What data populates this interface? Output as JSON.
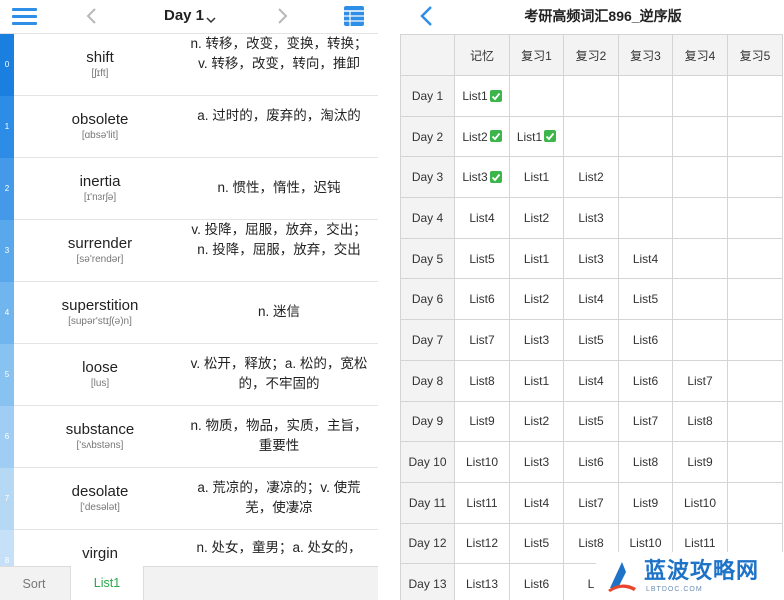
{
  "left_panel": {
    "header": {
      "title": "Day 1"
    },
    "rail_numbers": [
      "0",
      "1",
      "2",
      "3",
      "4",
      "5",
      "6",
      "7",
      "8"
    ],
    "words": [
      {
        "word": "shift",
        "phonetic": "[ʃɪft]",
        "definition": "n. 转移，改变，变换，转换；v. 转移，改变，转向，推卸"
      },
      {
        "word": "obsolete",
        "phonetic": "[ɑbsə'lit]",
        "definition": "a. 过时的，废弃的，淘汰的"
      },
      {
        "word": "inertia",
        "phonetic": "[ɪ'nɜrʃə]",
        "definition": "n. 惯性，惰性，迟钝"
      },
      {
        "word": "surrender",
        "phonetic": "[sə'rendər]",
        "definition": "v. 投降，屈服，放弃，交出；n. 投降，屈服，放弃，交出"
      },
      {
        "word": "superstition",
        "phonetic": "[supər'stɪʃ(ə)n]",
        "definition": "n. 迷信"
      },
      {
        "word": "loose",
        "phonetic": "[lus]",
        "definition": "v. 松开，释放；a. 松的，宽松的，不牢固的"
      },
      {
        "word": "substance",
        "phonetic": "['sʌbstəns]",
        "definition": "n. 物质，物品，实质，主旨，重要性"
      },
      {
        "word": "desolate",
        "phonetic": "['desələt]",
        "definition": "a. 荒凉的，凄凉的；v. 使荒芜，使凄凉"
      },
      {
        "word": "virgin",
        "phonetic": "",
        "definition": "n. 处女，童男；a. 处女的，"
      }
    ],
    "tabs": {
      "sort": "Sort",
      "list1": "List1"
    }
  },
  "right_panel": {
    "title": "考研高频词汇896_逆序版",
    "columns": [
      "",
      "记忆",
      "复习1",
      "复习2",
      "复习3",
      "复习4",
      "复习5"
    ],
    "rows": [
      {
        "day": "Day 1",
        "cells": [
          "List1",
          "",
          "",
          "",
          "",
          ""
        ],
        "checks": [
          true,
          false,
          false,
          false,
          false,
          false
        ]
      },
      {
        "day": "Day 2",
        "cells": [
          "List2",
          "List1",
          "",
          "",
          "",
          ""
        ],
        "checks": [
          true,
          true,
          false,
          false,
          false,
          false
        ]
      },
      {
        "day": "Day 3",
        "cells": [
          "List3",
          "List1",
          "List2",
          "",
          "",
          ""
        ],
        "checks": [
          true,
          false,
          false,
          false,
          false,
          false
        ]
      },
      {
        "day": "Day 4",
        "cells": [
          "List4",
          "List2",
          "List3",
          "",
          "",
          ""
        ],
        "checks": [
          false,
          false,
          false,
          false,
          false,
          false
        ]
      },
      {
        "day": "Day 5",
        "cells": [
          "List5",
          "List1",
          "List3",
          "List4",
          "",
          ""
        ],
        "checks": [
          false,
          false,
          false,
          false,
          false,
          false
        ]
      },
      {
        "day": "Day 6",
        "cells": [
          "List6",
          "List2",
          "List4",
          "List5",
          "",
          ""
        ],
        "checks": [
          false,
          false,
          false,
          false,
          false,
          false
        ]
      },
      {
        "day": "Day 7",
        "cells": [
          "List7",
          "List3",
          "List5",
          "List6",
          "",
          ""
        ],
        "checks": [
          false,
          false,
          false,
          false,
          false,
          false
        ]
      },
      {
        "day": "Day 8",
        "cells": [
          "List8",
          "List1",
          "List4",
          "List6",
          "List7",
          ""
        ],
        "checks": [
          false,
          false,
          false,
          false,
          false,
          false
        ]
      },
      {
        "day": "Day 9",
        "cells": [
          "List9",
          "List2",
          "List5",
          "List7",
          "List8",
          ""
        ],
        "checks": [
          false,
          false,
          false,
          false,
          false,
          false
        ]
      },
      {
        "day": "Day 10",
        "cells": [
          "List10",
          "List3",
          "List6",
          "List8",
          "List9",
          ""
        ],
        "checks": [
          false,
          false,
          false,
          false,
          false,
          false
        ]
      },
      {
        "day": "Day 11",
        "cells": [
          "List11",
          "List4",
          "List7",
          "List9",
          "List10",
          ""
        ],
        "checks": [
          false,
          false,
          false,
          false,
          false,
          false
        ]
      },
      {
        "day": "Day 12",
        "cells": [
          "List12",
          "List5",
          "List8",
          "List10",
          "List11",
          ""
        ],
        "checks": [
          false,
          false,
          false,
          false,
          false,
          false
        ]
      },
      {
        "day": "Day 13",
        "cells": [
          "List13",
          "List6",
          "L",
          "",
          "",
          ""
        ],
        "checks": [
          false,
          false,
          false,
          false,
          false,
          false
        ]
      }
    ]
  },
  "watermark": {
    "text": "蓝波攻略网",
    "sub": "LBTDOC.COM"
  },
  "colors": {
    "accent": "#2f8ee5",
    "tab_active": "#27a84a",
    "check_green": "#3cb64a"
  }
}
